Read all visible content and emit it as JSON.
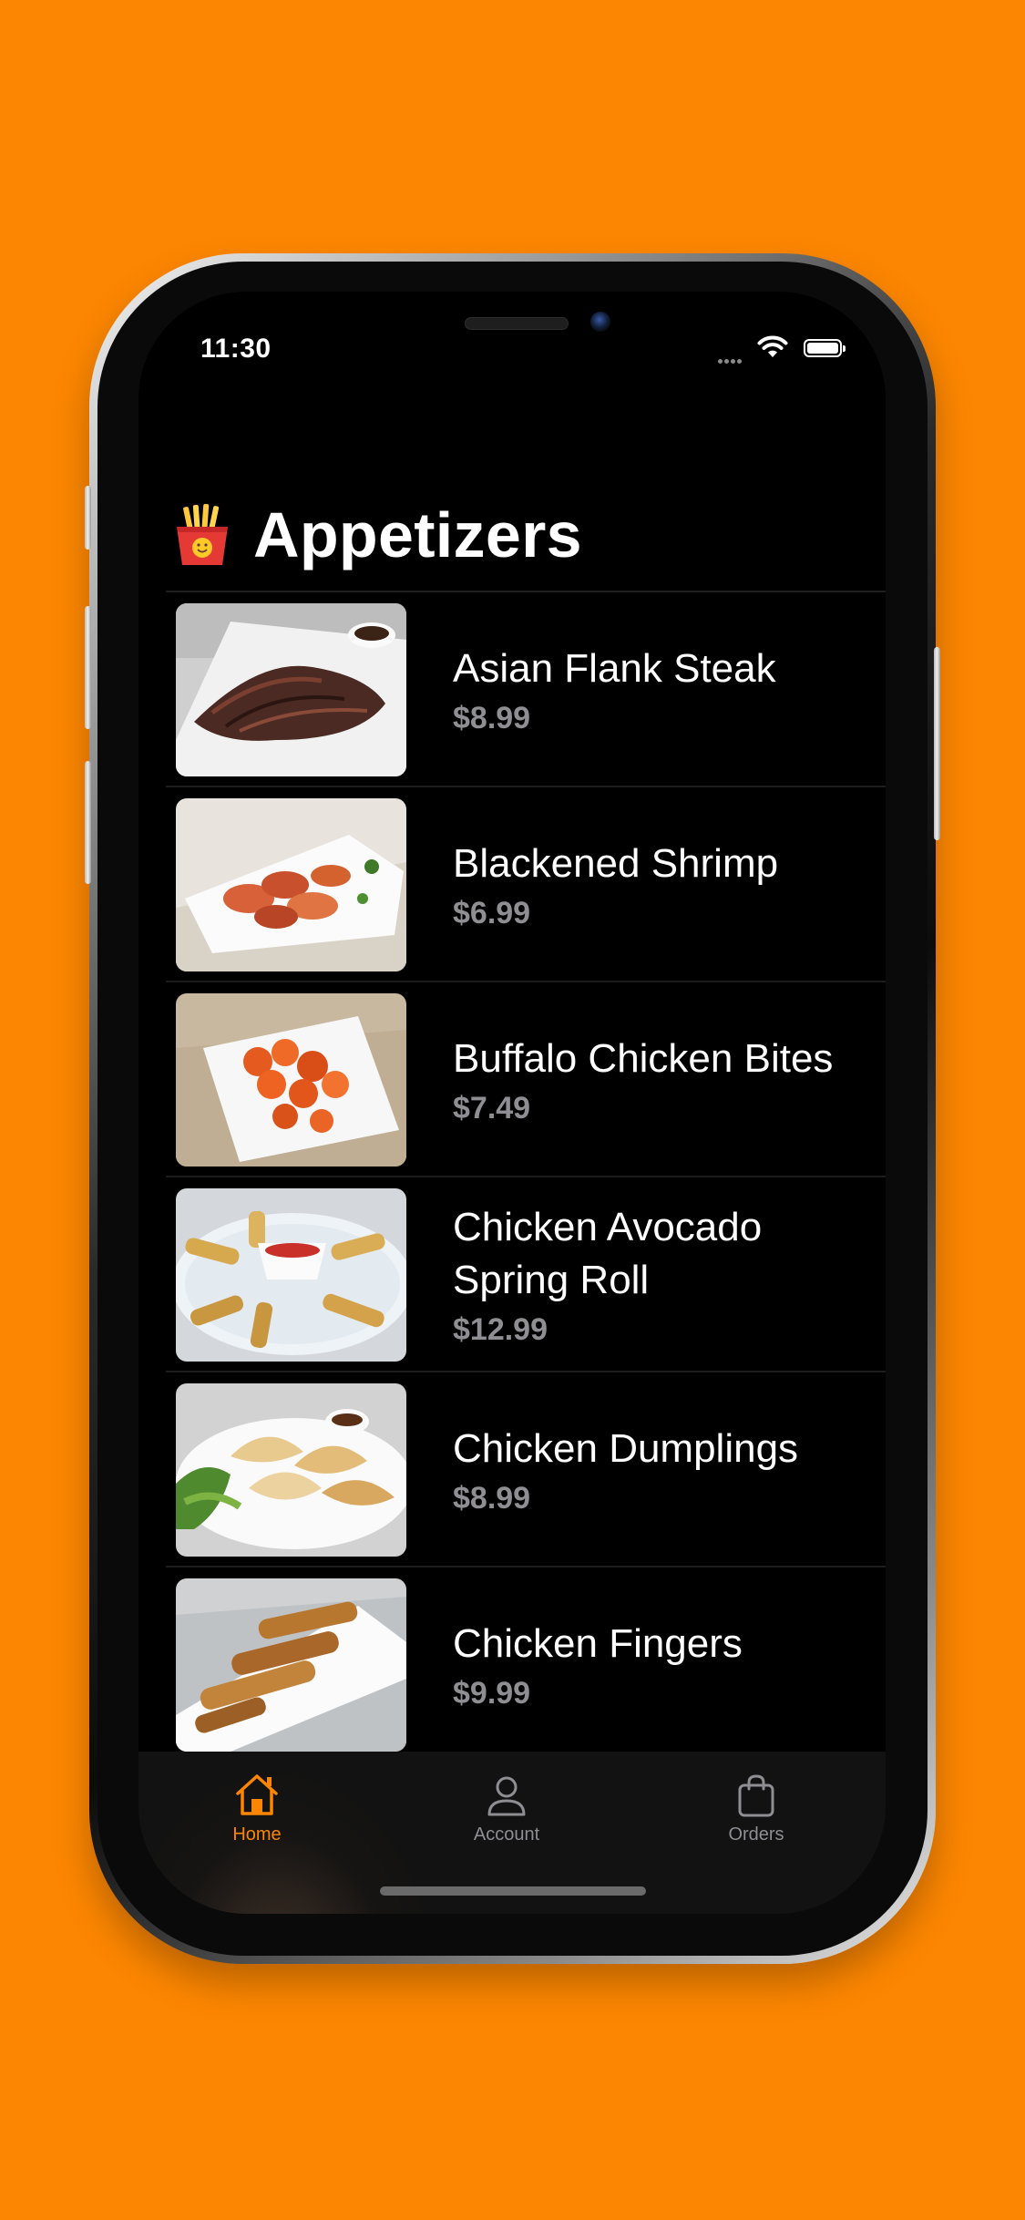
{
  "status_bar": {
    "time": "11:30"
  },
  "page": {
    "title": "Appetizers",
    "title_emoji": "french-fries"
  },
  "items": [
    {
      "name": "Asian Flank Steak",
      "price": "$8.99",
      "image": "flank-steak-photo"
    },
    {
      "name": "Blackened Shrimp",
      "price": "$6.99",
      "image": "shrimp-photo"
    },
    {
      "name": "Buffalo Chicken Bites",
      "price": "$7.49",
      "image": "chicken-bites-photo"
    },
    {
      "name": "Chicken Avocado Spring Roll",
      "price": "$12.99",
      "image": "spring-roll-photo"
    },
    {
      "name": "Chicken Dumplings",
      "price": "$8.99",
      "image": "dumplings-photo"
    },
    {
      "name": "Chicken Fingers",
      "price": "$9.99",
      "image": "chicken-fingers-photo"
    }
  ],
  "tab_bar": {
    "tabs": [
      {
        "label": "Home",
        "icon": "house-icon",
        "active": true
      },
      {
        "label": "Account",
        "icon": "person-icon",
        "active": false
      },
      {
        "label": "Orders",
        "icon": "bag-icon",
        "active": false
      }
    ]
  },
  "colors": {
    "background": "#FC8601",
    "accent": "#FC8601",
    "price": "#8e8e93"
  }
}
